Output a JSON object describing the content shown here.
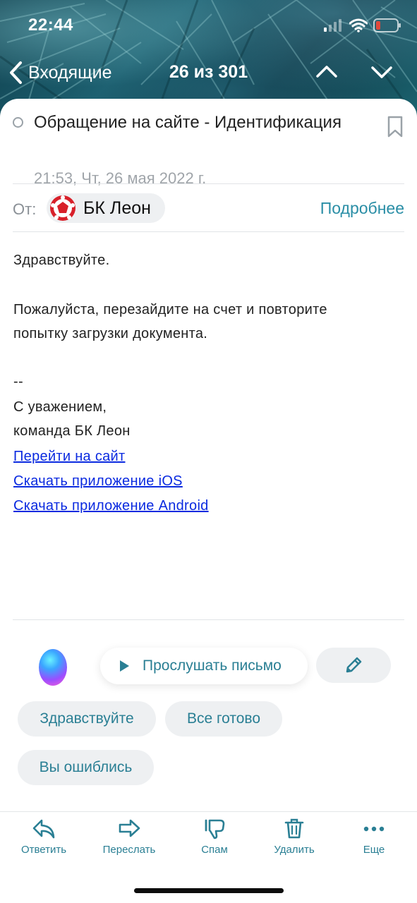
{
  "status_bar": {
    "time": "22:44"
  },
  "nav": {
    "back_label": "Входящие",
    "counter": "26 из 301"
  },
  "email": {
    "subject": "Обращение на сайте - Идентификация",
    "date": "21:53, Чт, 26 мая 2022 г.",
    "from_label": "От:",
    "sender": "БК Леон",
    "details_link": "Подробнее",
    "body": {
      "greeting": "Здравствуйте.",
      "line1": "Пожалуйста, перезайдите на счет и повторите",
      "line2": "попытку загрузки документа.",
      "separator": "--",
      "sign1": "С уважением,",
      "sign2": "команда БК Леон",
      "links": [
        "Перейти на сайт",
        "Скачать приложение iOS",
        "Скачать приложение Android"
      ]
    }
  },
  "assistant": {
    "listen_label": "Прослушать письмо",
    "quick_replies": [
      "Здравствуйте",
      "Все готово",
      "Вы ошиблись"
    ]
  },
  "toolbar": {
    "reply": "Ответить",
    "forward": "Переслать",
    "spam": "Спам",
    "delete": "Удалить",
    "more": "Еще"
  },
  "colors": {
    "accent": "#2a8ea6",
    "link": "#0a2ae0",
    "chip_bg": "#eef0f2",
    "battery_low": "#e0473a"
  },
  "icons": [
    "signal-icon",
    "wifi-icon",
    "battery-icon",
    "back-chevron-icon",
    "chevron-up-icon",
    "chevron-down-icon",
    "bookmark-icon",
    "sender-avatar-icon",
    "play-icon",
    "pencil-icon",
    "reply-icon",
    "forward-icon",
    "spam-icon",
    "trash-icon",
    "more-icon"
  ]
}
